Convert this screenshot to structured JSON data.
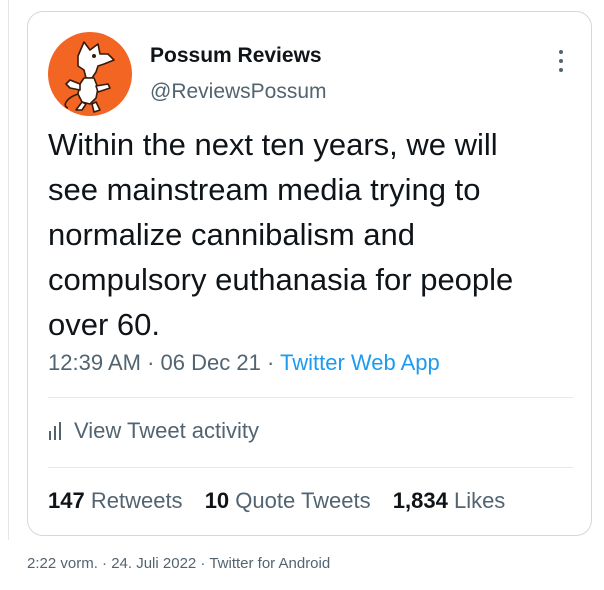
{
  "tweet": {
    "display_name": "Possum Reviews",
    "handle": "@ReviewsPossum",
    "text": "Within the next ten years, we will\nsee mainstream media trying to\nnormalize cannibalism and\ncompulsory euthanasia for people\nover 60.",
    "time": "12:39 AM",
    "date": "06 Dec 21",
    "separator": "·",
    "source": "Twitter Web App",
    "activity_label": "View Tweet activity",
    "stats": {
      "retweets_count": "147",
      "retweets_label": "Retweets",
      "quote_count": "10",
      "quote_label": "Quote Tweets",
      "likes_count": "1,834",
      "likes_label": "Likes"
    }
  },
  "footer": {
    "text": "2:22 vorm. · 24. Juli 2022 · Twitter for Android"
  },
  "icons": {
    "avatar": "possum-avatar-icon",
    "more": "more-options-icon",
    "activity": "bar-chart-icon"
  },
  "colors": {
    "link": "#1d9bf0",
    "avatar_bg": "#f26522",
    "text_primary": "#0f1419",
    "text_secondary": "#536471"
  }
}
